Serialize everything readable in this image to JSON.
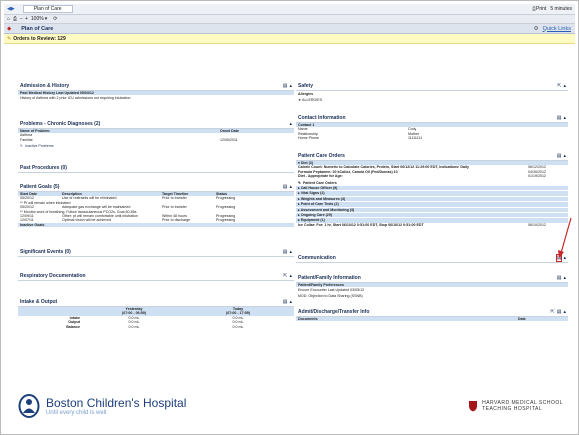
{
  "window": {
    "tab_title": "Plan of Care",
    "print_label": "Print",
    "timer": "5 minutes",
    "zoom": "100%"
  },
  "appbar": {
    "title": "Plan of Care",
    "quick_links": "Quick Links"
  },
  "orders": {
    "label": "Orders to Review: 129"
  },
  "left": {
    "admission": {
      "title": "Admission & History",
      "line1": "Past Medical History Last Updated 05/03/12",
      "line2": "History of Asthma with 2 prior ICU admissions not requiring intubation"
    },
    "problems": {
      "title": "Problems - Chronic Diagnoses (2)",
      "col_name": "Name of Problem",
      "col_date": "Onset Date",
      "rows": [
        {
          "name": "Asthma",
          "date": ""
        },
        {
          "name": "Familial",
          "date": "12/05/2011"
        }
      ],
      "inactive": "Inactive Problems"
    },
    "past_procedures": {
      "title": "Past Procedures (0)"
    },
    "patient_goals": {
      "title": "Patient Goals (5)",
      "headers": [
        "Start Date",
        "Description",
        "Target Timeline",
        "Status"
      ],
      "rows": [
        [
          "05/20/12",
          "Use of restraints will be eliminated",
          "Prior to transfer",
          "Progressing"
        ],
        [
          "** Pt will remain when intubated",
          "",
          "",
          ""
        ],
        [
          "05/20/12",
          "Adequate gas exchange will be maintained",
          "Prior to transfer",
          "Progressing"
        ],
        [
          "** Monitor work of breathing, Follow transcutaneous PCO2s, Goal 60-65s",
          "",
          "",
          ""
        ],
        [
          "12/09/11",
          "Other: pt will remain comfortable until intubation",
          "Within 48 hours",
          "Progressing"
        ],
        [
          "12/07/11",
          "Optimal vision will be achieved",
          "Prior to discharge",
          "Progressing"
        ]
      ],
      "inactive": "Inactive Goals"
    },
    "significant_events": {
      "title": "Significant Events (0)"
    },
    "respiratory": {
      "title": "Respiratory Documentation"
    },
    "intake": {
      "title": "Intake & Output",
      "yesterday": "Yesterday",
      "yesterday_range": "(07:00 - 06:59)",
      "today": "Today",
      "today_range": "(07:00 - 17:59)",
      "rows": [
        {
          "label": "Intake",
          "y": "0.0 mL",
          "t": "0.0 mL"
        },
        {
          "label": "Output",
          "y": "0.0 mL",
          "t": "0.0 mL"
        },
        {
          "label": "Balance",
          "y": "0.0 mL",
          "t": "0.0 mL"
        }
      ]
    }
  },
  "right": {
    "safety": {
      "title": "Safety",
      "allergies_label": "Allergies",
      "allergies_value": "ALLERGIES"
    },
    "contact": {
      "title": "Contact Information",
      "header": "Contact 1",
      "rows": [
        {
          "label": "Name",
          "value": "Cody"
        },
        {
          "label": "Relationship",
          "value": "Mother"
        },
        {
          "label": "Home Phone",
          "value": "11111111"
        }
      ]
    },
    "patient_orders": {
      "title": "Patient Care Orders",
      "diet_header": "Diet (3)",
      "diet_rows": [
        {
          "text": "Calorie Count: Numeric to Calculate Calories, Protein, Start 06/12/12 11:29:00 EDT, Indications: Daily",
          "date": "06/12/2012"
        },
        {
          "text": "Formula Peptamen: 20 kCal/oz, Canola Oil (Fed/Dumas) 10",
          "date": "04/30/2012"
        },
        {
          "text": "Diet - Appropriate for Age:",
          "date": "01/19/2012"
        }
      ],
      "patient_care_header": "Patient Care Orders",
      "groups": [
        "Call House Officer (9)",
        "Vital Signs (2)",
        "Weights and Measures (4)",
        "Point of Care Tests (2)",
        "Assessment and Monitoring (3)",
        "Ongoing Care (29)",
        "Equipment (1)"
      ],
      "ice_row": {
        "text": "Ice Collar: For: 1 hr, Start 06/10/12 0:51:00 EDT, Stop 06/10/12 0:51:00 EDT",
        "date": "06/10/2012"
      }
    },
    "communication": {
      "title": "Communication"
    },
    "family": {
      "title": "Patient/Family Information",
      "header": "Patient/Family Preferences",
      "line1": "Encore Encounter Last Updated 03/05/12",
      "line2": "MOD: Objection to Data Sharing (SSNB)"
    },
    "admit": {
      "title": "Admit/Discharge/Transfer Info",
      "col1": "Documents",
      "col2": "Date"
    }
  },
  "footer": {
    "hospital_name": "Boston Children's Hospital",
    "tagline": "Until every child is well",
    "harvard_line1": "HARVARD MEDICAL SCHOOL",
    "harvard_line2": "TEACHING HOSPITAL"
  },
  "colors": {
    "accent_blue": "#1d3f7a",
    "header_blue": "#cfe0f3",
    "orders_yellow": "#fffac2",
    "arrow_red": "#c62828"
  }
}
